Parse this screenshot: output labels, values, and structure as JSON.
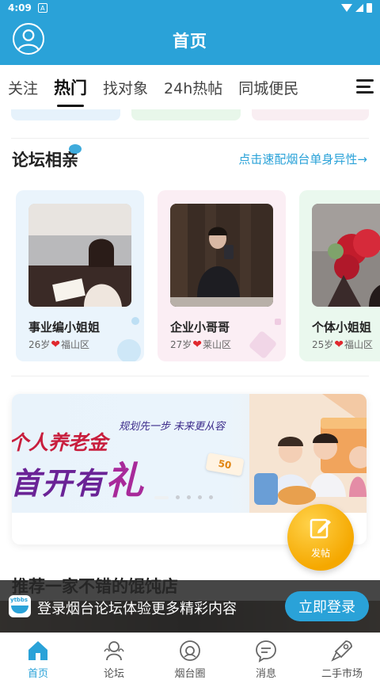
{
  "status_bar": {
    "time": "4:09"
  },
  "header": {
    "title": "首页"
  },
  "tabs": [
    {
      "label": "关注",
      "active": false
    },
    {
      "label": "热门",
      "active": true
    },
    {
      "label": "找对象",
      "active": false
    },
    {
      "label": "24h热帖",
      "active": false
    },
    {
      "label": "同城便民",
      "active": false
    }
  ],
  "section": {
    "title": "论坛相亲",
    "link": "点击速配烟台单身异性→"
  },
  "profiles": [
    {
      "name": "事业编小姐姐",
      "age": "26岁",
      "district": "福山区"
    },
    {
      "name": "企业小哥哥",
      "age": "27岁",
      "district": "莱山区"
    },
    {
      "name": "个体小姐姐",
      "age": "25岁",
      "district": "福山区"
    }
  ],
  "banner": {
    "line1": "个人养老金",
    "line2a": "首开有",
    "line2b": "礼",
    "slogan": "规划先一步 未来更从容",
    "badge": "50"
  },
  "fab": {
    "label": "发帖"
  },
  "article": {
    "title": "推荐一家不错的馄饨店"
  },
  "login_prompt": {
    "logo_text": "ytbbs",
    "text": "登录烟台论坛体验更多精彩内容",
    "button": "立即登录"
  },
  "bottom_nav": [
    {
      "label": "首页",
      "icon": "home-icon",
      "active": true
    },
    {
      "label": "论坛",
      "icon": "forum-icon",
      "active": false
    },
    {
      "label": "烟台圈",
      "icon": "circle-icon",
      "active": false
    },
    {
      "label": "消息",
      "icon": "message-icon",
      "active": false
    },
    {
      "label": "二手市场",
      "icon": "market-icon",
      "active": false
    }
  ],
  "colors": {
    "brand": "#2aa2d8",
    "heart": "#e0282e",
    "fab": "#f5a800"
  }
}
